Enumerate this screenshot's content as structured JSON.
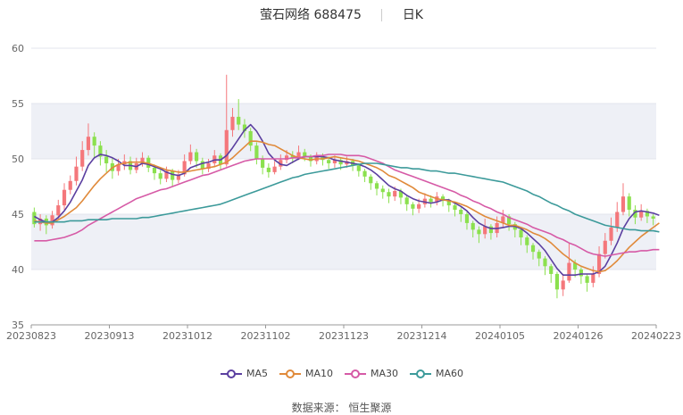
{
  "header": {
    "stock_name": "萤石网络 688475",
    "period": "日K"
  },
  "source": {
    "label": "数据来源：",
    "provider": "恒生聚源"
  },
  "colors": {
    "up": "#f4777b",
    "down": "#8be04e",
    "ma5": "#5b3fa0",
    "ma10": "#e08a3a",
    "ma30": "#d65aa6",
    "ma60": "#3c9a9a",
    "band": "#eef0f6"
  },
  "chart_data": {
    "type": "candlestick",
    "x_ticks": [
      "20230823",
      "20230913",
      "20231012",
      "20231102",
      "20231123",
      "20231214",
      "20240105",
      "20240126",
      "20240223"
    ],
    "ylim": [
      35,
      60
    ],
    "y_ticks": [
      35,
      40,
      45,
      50,
      55,
      60
    ],
    "legend": [
      "MA5",
      "MA10",
      "MA30",
      "MA60"
    ],
    "legend_position": "bottom",
    "candles": [
      [
        45.2,
        44.1,
        45.6,
        43.8
      ],
      [
        44.1,
        44.6,
        45.0,
        43.5
      ],
      [
        44.6,
        44.0,
        44.9,
        43.2
      ],
      [
        44.0,
        44.9,
        45.3,
        43.7
      ],
      [
        44.9,
        45.8,
        46.3,
        44.6
      ],
      [
        45.8,
        47.2,
        47.8,
        45.4
      ],
      [
        47.2,
        48.0,
        48.5,
        46.8
      ],
      [
        48.0,
        49.3,
        50.2,
        47.6
      ],
      [
        49.3,
        50.8,
        51.6,
        48.9
      ],
      [
        50.8,
        52.0,
        53.2,
        50.3
      ],
      [
        52.0,
        51.2,
        52.4,
        50.1
      ],
      [
        51.2,
        50.2,
        51.6,
        49.4
      ],
      [
        50.2,
        49.6,
        50.8,
        48.8
      ],
      [
        49.6,
        48.9,
        50.1,
        48.2
      ],
      [
        48.9,
        49.5,
        50.0,
        48.5
      ],
      [
        49.5,
        49.8,
        50.4,
        49.0
      ],
      [
        49.8,
        49.0,
        50.2,
        48.6
      ],
      [
        49.0,
        49.6,
        50.1,
        48.7
      ],
      [
        49.6,
        50.1,
        50.6,
        49.3
      ],
      [
        50.1,
        49.2,
        50.3,
        48.8
      ],
      [
        49.2,
        48.7,
        49.5,
        48.1
      ],
      [
        48.7,
        48.2,
        49.0,
        47.7
      ],
      [
        48.2,
        48.9,
        49.3,
        47.9
      ],
      [
        48.9,
        48.1,
        49.1,
        47.5
      ],
      [
        48.1,
        48.6,
        49.0,
        47.8
      ],
      [
        48.6,
        49.8,
        50.4,
        48.4
      ],
      [
        49.8,
        50.6,
        51.3,
        49.5
      ],
      [
        50.6,
        49.8,
        50.9,
        49.2
      ],
      [
        49.8,
        49.1,
        50.1,
        48.6
      ],
      [
        49.1,
        49.6,
        50.0,
        48.8
      ],
      [
        49.6,
        50.3,
        50.8,
        49.3
      ],
      [
        50.3,
        49.5,
        50.5,
        49.0
      ],
      [
        49.5,
        52.6,
        57.6,
        49.3
      ],
      [
        52.6,
        53.8,
        54.6,
        52.0
      ],
      [
        53.8,
        53.1,
        55.4,
        52.6
      ],
      [
        53.1,
        52.5,
        53.6,
        51.9
      ],
      [
        52.5,
        51.2,
        52.8,
        50.7
      ],
      [
        51.2,
        50.0,
        51.5,
        49.5
      ],
      [
        50.0,
        49.2,
        50.3,
        48.6
      ],
      [
        49.2,
        48.8,
        49.6,
        48.3
      ],
      [
        48.8,
        49.3,
        49.8,
        48.6
      ],
      [
        49.3,
        49.9,
        50.4,
        49.0
      ],
      [
        49.9,
        50.3,
        50.8,
        49.6
      ],
      [
        50.3,
        50.1,
        50.7,
        49.6
      ],
      [
        50.1,
        50.6,
        51.2,
        49.9
      ],
      [
        50.6,
        50.2,
        50.9,
        49.8
      ],
      [
        50.2,
        49.8,
        50.4,
        49.3
      ],
      [
        49.8,
        50.2,
        50.6,
        49.5
      ],
      [
        50.2,
        49.9,
        50.5,
        49.4
      ],
      [
        49.9,
        49.6,
        50.2,
        49.1
      ],
      [
        49.6,
        49.9,
        50.3,
        49.2
      ],
      [
        49.9,
        49.5,
        50.1,
        49.0
      ],
      [
        49.5,
        49.8,
        50.2,
        49.2
      ],
      [
        49.8,
        49.4,
        50.0,
        48.9
      ],
      [
        49.4,
        48.9,
        49.6,
        48.4
      ],
      [
        48.9,
        48.4,
        49.1,
        47.9
      ],
      [
        48.4,
        47.8,
        48.6,
        47.2
      ],
      [
        47.8,
        47.3,
        48.0,
        46.7
      ],
      [
        47.3,
        47.0,
        47.6,
        46.4
      ],
      [
        47.0,
        46.6,
        47.3,
        46.0
      ],
      [
        46.6,
        47.1,
        47.5,
        46.2
      ],
      [
        47.1,
        46.5,
        47.3,
        45.9
      ],
      [
        46.5,
        45.9,
        46.7,
        45.3
      ],
      [
        45.9,
        45.5,
        46.1,
        44.9
      ],
      [
        45.5,
        45.9,
        46.4,
        45.1
      ],
      [
        45.9,
        46.4,
        46.9,
        45.6
      ],
      [
        46.4,
        46.1,
        46.7,
        45.6
      ],
      [
        46.1,
        46.6,
        47.0,
        45.8
      ],
      [
        46.6,
        46.2,
        46.8,
        45.7
      ],
      [
        46.2,
        45.8,
        46.4,
        45.2
      ],
      [
        45.8,
        45.4,
        46.0,
        44.8
      ],
      [
        45.4,
        45.0,
        45.6,
        44.3
      ],
      [
        45.0,
        44.2,
        45.2,
        43.6
      ],
      [
        44.2,
        43.6,
        44.4,
        42.9
      ],
      [
        43.6,
        43.2,
        43.9,
        42.4
      ],
      [
        43.2,
        43.9,
        44.6,
        42.8
      ],
      [
        43.9,
        43.3,
        44.1,
        42.7
      ],
      [
        43.3,
        44.2,
        44.8,
        42.9
      ],
      [
        44.2,
        44.8,
        45.4,
        43.8
      ],
      [
        44.8,
        44.1,
        45.0,
        43.5
      ],
      [
        44.1,
        43.6,
        44.3,
        42.9
      ],
      [
        43.6,
        42.9,
        43.8,
        42.2
      ],
      [
        42.9,
        42.2,
        43.1,
        41.5
      ],
      [
        42.2,
        41.6,
        42.4,
        40.9
      ],
      [
        41.6,
        41.0,
        41.8,
        40.3
      ],
      [
        41.0,
        40.3,
        41.2,
        39.5
      ],
      [
        40.3,
        39.6,
        40.5,
        38.8
      ],
      [
        39.6,
        38.2,
        39.8,
        37.4
      ],
      [
        38.2,
        39.0,
        39.6,
        37.6
      ],
      [
        39.0,
        40.6,
        42.4,
        38.8
      ],
      [
        40.6,
        40.0,
        40.9,
        39.3
      ],
      [
        40.0,
        39.4,
        40.2,
        38.7
      ],
      [
        39.4,
        38.8,
        39.6,
        38.0
      ],
      [
        38.8,
        39.6,
        40.3,
        38.4
      ],
      [
        39.6,
        41.4,
        42.1,
        39.3
      ],
      [
        41.4,
        42.6,
        43.3,
        41.0
      ],
      [
        42.6,
        43.8,
        44.7,
        42.2
      ],
      [
        43.8,
        45.2,
        46.1,
        43.4
      ],
      [
        45.2,
        46.6,
        47.8,
        44.9
      ],
      [
        46.6,
        45.4,
        46.9,
        44.8
      ],
      [
        45.4,
        44.7,
        45.8,
        44.1
      ],
      [
        44.7,
        45.3,
        45.9,
        44.4
      ],
      [
        45.3,
        44.8,
        45.5,
        44.2
      ],
      [
        44.8,
        44.6,
        45.0,
        44.0
      ]
    ],
    "series": [
      {
        "name": "MA5",
        "values": [
          44.8,
          44.5,
          44.3,
          44.3,
          44.7,
          45.3,
          46.1,
          47.1,
          48.1,
          49.4,
          50.1,
          50.4,
          50.3,
          50.1,
          49.8,
          49.4,
          49.4,
          49.3,
          49.6,
          49.5,
          49.3,
          49.1,
          48.8,
          48.6,
          48.5,
          48.7,
          49.2,
          49.4,
          49.6,
          49.7,
          49.9,
          49.9,
          50.3,
          51.0,
          51.8,
          52.6,
          53.1,
          52.5,
          51.6,
          50.5,
          49.9,
          49.5,
          49.4,
          49.7,
          50.0,
          50.2,
          50.2,
          50.2,
          50.2,
          50.1,
          49.9,
          49.8,
          49.7,
          49.6,
          49.5,
          49.3,
          49.0,
          48.6,
          48.1,
          47.6,
          47.3,
          47.1,
          46.7,
          46.4,
          46.2,
          46.1,
          46.0,
          46.1,
          46.3,
          46.3,
          46.0,
          45.7,
          45.3,
          44.7,
          44.2,
          43.9,
          43.7,
          43.7,
          43.8,
          43.9,
          43.9,
          43.7,
          43.3,
          42.8,
          42.3,
          41.7,
          40.9,
          40.1,
          39.5,
          39.5,
          39.5,
          39.6,
          39.6,
          39.6,
          39.8,
          40.3,
          41.3,
          42.4,
          43.7,
          44.6,
          45.2,
          45.3,
          45.2,
          45.1,
          44.9
        ]
      },
      {
        "name": "MA10",
        "values": [
          44.4,
          44.3,
          44.2,
          44.2,
          44.5,
          44.8,
          45.2,
          45.6,
          46.2,
          46.9,
          47.6,
          48.2,
          48.7,
          49.2,
          49.5,
          49.6,
          49.7,
          49.7,
          49.7,
          49.6,
          49.4,
          49.2,
          49.0,
          48.9,
          48.8,
          48.8,
          48.9,
          49.0,
          49.1,
          49.2,
          49.3,
          49.5,
          49.7,
          50.1,
          50.6,
          51.1,
          51.6,
          51.6,
          51.5,
          51.3,
          51.2,
          50.9,
          50.6,
          50.3,
          50.1,
          50.0,
          49.9,
          50.0,
          50.0,
          50.1,
          50.2,
          50.1,
          50.0,
          49.9,
          49.8,
          49.6,
          49.4,
          49.2,
          48.9,
          48.5,
          48.3,
          48.0,
          47.7,
          47.4,
          47.0,
          46.8,
          46.6,
          46.4,
          46.3,
          46.2,
          46.1,
          45.9,
          45.7,
          45.4,
          45.1,
          44.8,
          44.6,
          44.4,
          44.2,
          44.0,
          44.0,
          43.8,
          43.6,
          43.3,
          43.1,
          42.8,
          42.4,
          41.9,
          41.4,
          41.0,
          40.6,
          40.3,
          40.1,
          39.9,
          39.8,
          39.9,
          40.3,
          40.8,
          41.4,
          42.0,
          42.5,
          43.0,
          43.4,
          43.8,
          44.2
        ]
      },
      {
        "name": "MA30",
        "values": [
          42.6,
          42.6,
          42.6,
          42.7,
          42.8,
          42.9,
          43.1,
          43.3,
          43.6,
          44.0,
          44.3,
          44.6,
          44.9,
          45.2,
          45.5,
          45.8,
          46.1,
          46.4,
          46.6,
          46.8,
          47.0,
          47.2,
          47.3,
          47.5,
          47.7,
          47.9,
          48.1,
          48.3,
          48.5,
          48.6,
          48.8,
          49.0,
          49.2,
          49.4,
          49.6,
          49.8,
          49.9,
          50.0,
          50.0,
          50.0,
          50.0,
          50.0,
          50.0,
          50.1,
          50.1,
          50.2,
          50.2,
          50.3,
          50.3,
          50.4,
          50.4,
          50.4,
          50.3,
          50.3,
          50.3,
          50.2,
          50.0,
          49.8,
          49.6,
          49.3,
          49.0,
          48.8,
          48.6,
          48.4,
          48.2,
          48.0,
          47.8,
          47.6,
          47.4,
          47.2,
          47.0,
          46.7,
          46.5,
          46.2,
          46.0,
          45.7,
          45.5,
          45.2,
          45.0,
          44.7,
          44.5,
          44.3,
          44.1,
          43.8,
          43.6,
          43.4,
          43.2,
          42.9,
          42.7,
          42.4,
          42.2,
          41.9,
          41.6,
          41.4,
          41.3,
          41.2,
          41.3,
          41.4,
          41.5,
          41.6,
          41.6,
          41.7,
          41.7,
          41.8,
          41.8
        ]
      },
      {
        "name": "MA60",
        "values": [
          44.3,
          44.3,
          44.3,
          44.3,
          44.3,
          44.3,
          44.4,
          44.4,
          44.4,
          44.5,
          44.5,
          44.5,
          44.5,
          44.6,
          44.6,
          44.6,
          44.6,
          44.6,
          44.7,
          44.7,
          44.8,
          44.9,
          45.0,
          45.1,
          45.2,
          45.3,
          45.4,
          45.5,
          45.6,
          45.7,
          45.8,
          45.9,
          46.1,
          46.3,
          46.5,
          46.7,
          46.9,
          47.1,
          47.3,
          47.5,
          47.7,
          47.9,
          48.1,
          48.3,
          48.4,
          48.6,
          48.7,
          48.8,
          48.9,
          49.0,
          49.1,
          49.2,
          49.3,
          49.4,
          49.5,
          49.6,
          49.6,
          49.6,
          49.5,
          49.4,
          49.3,
          49.2,
          49.2,
          49.1,
          49.1,
          49.0,
          48.9,
          48.9,
          48.8,
          48.7,
          48.7,
          48.6,
          48.5,
          48.4,
          48.3,
          48.2,
          48.1,
          48.0,
          47.9,
          47.7,
          47.5,
          47.3,
          47.1,
          46.8,
          46.6,
          46.3,
          46.0,
          45.8,
          45.5,
          45.3,
          45.0,
          44.8,
          44.6,
          44.4,
          44.2,
          44.0,
          43.9,
          43.8,
          43.7,
          43.6,
          43.6,
          43.5,
          43.5,
          43.5,
          43.4
        ]
      }
    ]
  }
}
